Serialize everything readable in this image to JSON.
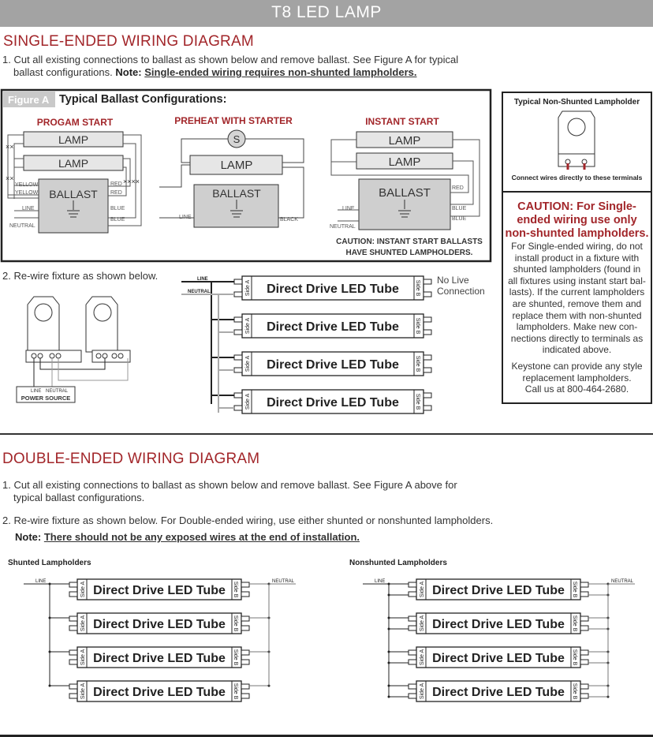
{
  "banner": {
    "title": "T8 LED LAMP"
  },
  "single_ended": {
    "heading": "SINGLE-ENDED WIRING DIAGRAM",
    "step1_text": "1. Cut all existing connections to ballast as shown below and remove ballast. See Figure A for typical",
    "step1_text2": "ballast configurations.",
    "step1_note_label": "Note:",
    "step1_note": "Single-ended wiring requires non-shunted lampholders.",
    "figure_a": {
      "tag": "Figure A",
      "title": "Typical Ballast Configurations:",
      "program_start": {
        "title": "PROGAM START",
        "lamp_label": "LAMP",
        "ballast_label": "BALLAST",
        "wire_labels": {
          "yellow": "YELLOW",
          "red": "RED",
          "blue": "BLUE",
          "line": "LINE",
          "neutral": "NEUTRAL"
        }
      },
      "preheat": {
        "title": "PREHEAT WITH STARTER",
        "starter_label": "S",
        "lamp_label": "LAMP",
        "ballast_label": "BALLAST",
        "wire_labels": {
          "line": "LINE",
          "black": "BLACK"
        }
      },
      "instant_start": {
        "title": "INSTANT START",
        "lamp_label": "LAMP",
        "ballast_label": "BALLAST",
        "wire_labels": {
          "red": "RED",
          "blue": "BLUE",
          "line": "LINE",
          "neutral": "NEUTRAL"
        },
        "caution_line1": "CAUTION: INSTANT START BALLASTS",
        "caution_line2": "HAVE SHUNTED LAMPHOLDERS."
      }
    },
    "lampholder_box": {
      "title": "Typical Non-Shunted Lampholder",
      "caption": "Connect wires directly to these terminals"
    },
    "caution_box": {
      "title_lines": [
        "CAUTION: For Single-",
        "ended wiring use only",
        "non-shunted lampholders."
      ],
      "body_lines": [
        "For Single-ended wiring, do not",
        "install product in a fixture with",
        "shunted lampholders (found in",
        "all fixtures using instant start bal-",
        "lasts). If the current lampholders",
        "are shunted, remove them and",
        "replace them with non-shunted",
        "lampholders. Make new con-",
        "nections directly to terminals as",
        "indicated above."
      ],
      "contact_lines": [
        "Keystone can provide any style",
        "replacement lampholders.",
        "Call us at 800-464-2680."
      ]
    },
    "step2_text": "2. Re-wire fixture as shown below.",
    "power_source": {
      "line": "LINE",
      "neutral": "NEUTRAL",
      "label": "POWER SOURCE"
    },
    "tube_diagram": {
      "line_label": "LINE",
      "neutral_label": "NEUTRAL",
      "no_live_line1": "No Live",
      "no_live_line2": "Connection",
      "tubes": [
        "Direct Drive LED Tube",
        "Direct Drive LED Tube",
        "Direct Drive LED Tube",
        "Direct Drive LED Tube"
      ],
      "side_a": "Side A",
      "side_b": "Side B"
    }
  },
  "double_ended": {
    "heading": "DOUBLE-ENDED WIRING DIAGRAM",
    "step1_text": "1. Cut all existing connections to ballast as shown below and remove ballast. See Figure A above for",
    "step1_text2": "typical ballast configurations.",
    "step2_text": "2. Re-wire fixture as shown below. For Double-ended wiring, use either shunted or nonshunted lampholders.",
    "note_label": "Note:",
    "note": "There should not be any exposed wires at the end of installation.",
    "shunted": {
      "title": "Shunted Lampholders",
      "line_label": "LINE",
      "neutral_label": "NEUTRAL",
      "tubes": [
        "Direct Drive LED Tube",
        "Direct Drive LED Tube",
        "Direct Drive LED Tube",
        "Direct Drive LED Tube"
      ],
      "side_a": "Side A",
      "side_b": "Side B"
    },
    "nonshunted": {
      "title": "Nonshunted Lampholders",
      "line_label": "LINE",
      "neutral_label": "NEUTRAL",
      "tubes": [
        "Direct Drive LED Tube",
        "Direct Drive LED Tube",
        "Direct Drive LED Tube",
        "Direct Drive LED Tube"
      ],
      "side_a": "Side A",
      "side_b": "Side B"
    }
  },
  "colors": {
    "accent_red": "#a2262a",
    "banner_gray": "#a3a3a3",
    "lamp_fill": "#e6e6e6",
    "ballast_fill": "#cfcfcf"
  }
}
